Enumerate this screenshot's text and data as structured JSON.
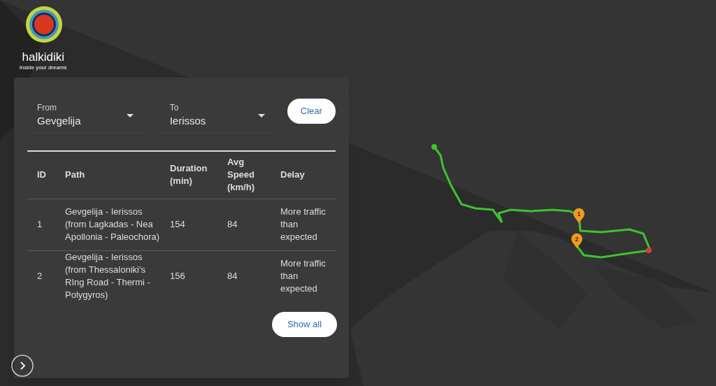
{
  "logo": {
    "name": "halkidiki",
    "tagline": "inside your dreams"
  },
  "route_form": {
    "from": {
      "label": "From",
      "value": "Gevgelija"
    },
    "to": {
      "label": "To",
      "value": "Ierissos"
    },
    "clear_button": "Clear"
  },
  "table": {
    "columns": [
      "ID",
      "Path",
      "Duration (min)",
      "Avg Speed (km/h)",
      "Delay"
    ],
    "rows": [
      {
        "id": "1",
        "path": "Gevgelija - Ierissos (from Lagkadas - Nea Apollonia - Paleochora)",
        "duration": "154",
        "avg_speed": "84",
        "delay": "More traffic than expected"
      },
      {
        "id": "2",
        "path": "Gevgelija - Ierissos (from Thessaloniki's RIng Road - Thermi - Polygyros)",
        "duration": "156",
        "avg_speed": "84",
        "delay": "More traffic than expected"
      }
    ]
  },
  "show_all_button": "Show all",
  "map": {
    "markers": [
      {
        "label": "1"
      },
      {
        "label": "2"
      }
    ]
  }
}
